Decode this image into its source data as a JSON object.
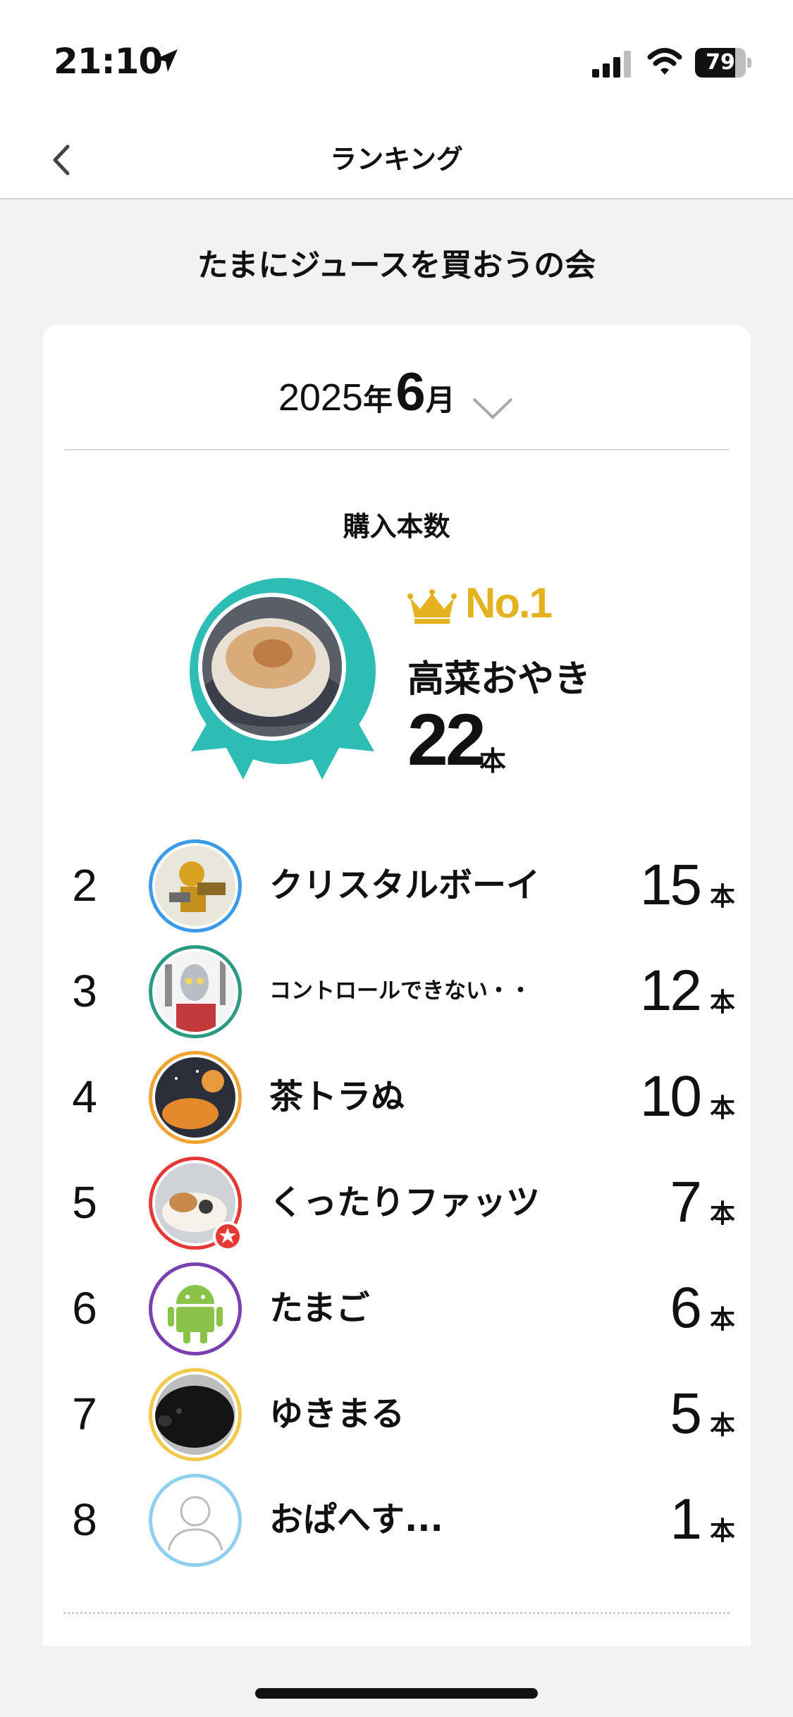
{
  "status_bar": {
    "time": "21:10",
    "battery": "79",
    "battery_level": 0.79
  },
  "nav": {
    "title": "ランキング"
  },
  "group": {
    "title": "たまにジュースを買おうの会"
  },
  "period": {
    "year": "2025",
    "year_unit": "年",
    "month": "6",
    "month_unit": "月"
  },
  "metric": {
    "label": "購入本数"
  },
  "top_rank": {
    "badge": "No.1",
    "name": "高菜おやき",
    "count": "22",
    "unit": "本"
  },
  "ranking": [
    {
      "rank": "2",
      "name": "クリスタルボーイ",
      "count": "15",
      "unit": "本",
      "ring_color": "#3b9be8"
    },
    {
      "rank": "3",
      "name": "コントロールできない・・",
      "count": "12",
      "unit": "本",
      "ring_color": "#2a9a82"
    },
    {
      "rank": "4",
      "name": "茶トラぬ",
      "count": "10",
      "unit": "本",
      "ring_color": "#f0a431"
    },
    {
      "rank": "5",
      "name": "くったりファッツ",
      "count": "7",
      "unit": "本",
      "ring_color": "#e53935"
    },
    {
      "rank": "6",
      "name": "たまご",
      "count": "6",
      "unit": "本",
      "ring_color": "#7a3fb0"
    },
    {
      "rank": "7",
      "name": "ゆきまる",
      "count": "5",
      "unit": "本",
      "ring_color": "#f2c94c"
    },
    {
      "rank": "8",
      "name": "おぱへす...",
      "count": "1",
      "unit": "本",
      "ring_color": "#8fcff0"
    }
  ],
  "colors": {
    "medal": "#2ebdb4",
    "gold": "#e5b21f"
  },
  "icons": [
    "location-arrow-icon",
    "signal-icon",
    "wifi-icon",
    "battery-icon",
    "back-chevron-icon",
    "chevron-down-icon",
    "crown-icon",
    "star-badge-icon",
    "default-avatar-icon",
    "android-icon"
  ]
}
